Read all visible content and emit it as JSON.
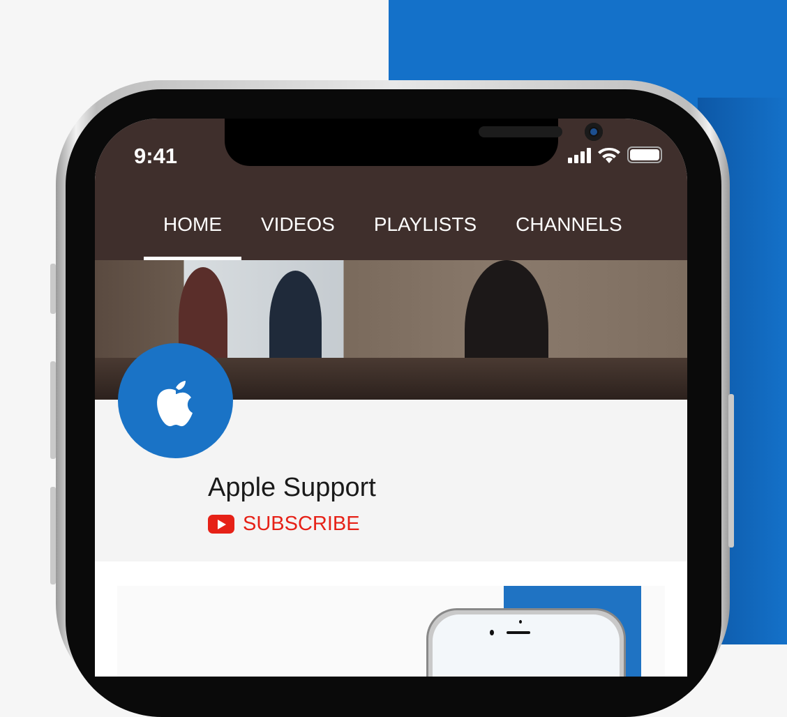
{
  "colors": {
    "accent": "#1471c9",
    "header": "#3f2f2c",
    "subscribe": "#e62117",
    "avatar": "#1a73c6"
  },
  "status_bar": {
    "time": "9:41",
    "icons": [
      "cellular-signal-icon",
      "wifi-icon",
      "battery-icon"
    ]
  },
  "tabs": [
    {
      "label": "HOME",
      "active": true
    },
    {
      "label": "VIDEOS"
    },
    {
      "label": "PLAYLISTS"
    },
    {
      "label": "CHANNELS"
    }
  ],
  "channel": {
    "name": "Apple Support",
    "subscribe_label": "SUBSCRIBE",
    "avatar_icon": "apple-logo-icon"
  }
}
